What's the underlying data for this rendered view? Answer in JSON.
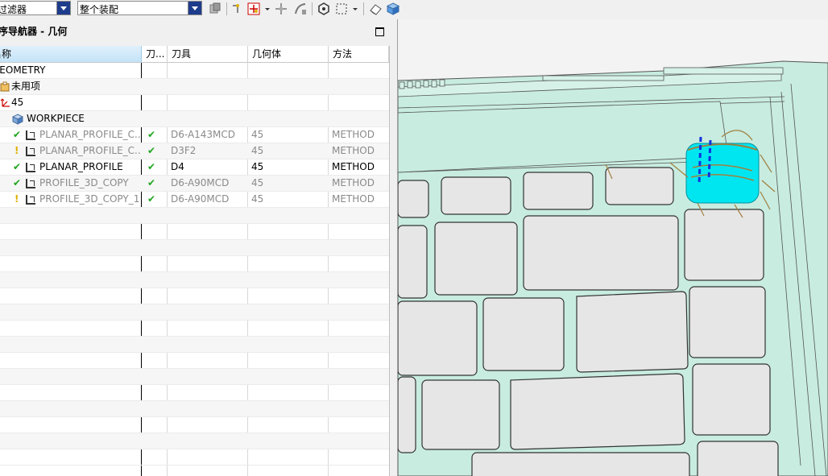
{
  "toolbar": {
    "filter_combo_value": "过滤器",
    "assembly_combo_value": "整个装配"
  },
  "navigator": {
    "title": "工序导航器 - 几何",
    "columns": [
      "名称",
      "刀...",
      "刀具",
      "几何体",
      "方法"
    ],
    "rows": [
      {
        "name": "GEOMETRY",
        "status": "",
        "tool": "",
        "geometry": "",
        "method": "",
        "dim": false
      },
      {
        "name": "未用项",
        "status": "",
        "tool": "",
        "geometry": "",
        "method": "",
        "dim": false
      },
      {
        "name": "45",
        "status": "",
        "tool": "",
        "geometry": "",
        "method": "",
        "dim": false
      },
      {
        "name": "WORKPIECE",
        "status": "",
        "tool": "",
        "geometry": "",
        "method": "",
        "dim": false
      },
      {
        "name": "PLANAR_PROFILE_C...",
        "status": "✔",
        "tool": "D6-A143MCD",
        "geometry": "45",
        "method": "METHOD",
        "dim": true
      },
      {
        "name": "PLANAR_PROFILE_C...",
        "status": "✔",
        "tool": "D3F2",
        "geometry": "45",
        "method": "METHOD",
        "dim": true
      },
      {
        "name": "PLANAR_PROFILE",
        "status": "✔",
        "tool": "D4",
        "geometry": "45",
        "method": "METHOD",
        "dim": false
      },
      {
        "name": "PROFILE_3D_COPY",
        "status": "✔",
        "tool": "D6-A90MCD",
        "geometry": "45",
        "method": "METHOD",
        "dim": true
      },
      {
        "name": "PROFILE_3D_COPY_1",
        "status": "✔",
        "tool": "D6-A90MCD",
        "geometry": "45",
        "method": "METHOD",
        "dim": true
      }
    ],
    "row_status_marks": [
      "",
      "",
      "",
      "",
      "✔",
      "!",
      "✔",
      "✔",
      "!"
    ]
  },
  "colors": {
    "model_face": "#c8ece0",
    "key_face": "#e6e6e6",
    "tool_highlight": "#00e6f0",
    "check_green": "#1fa51f",
    "warn_yellow": "#e0b000"
  }
}
